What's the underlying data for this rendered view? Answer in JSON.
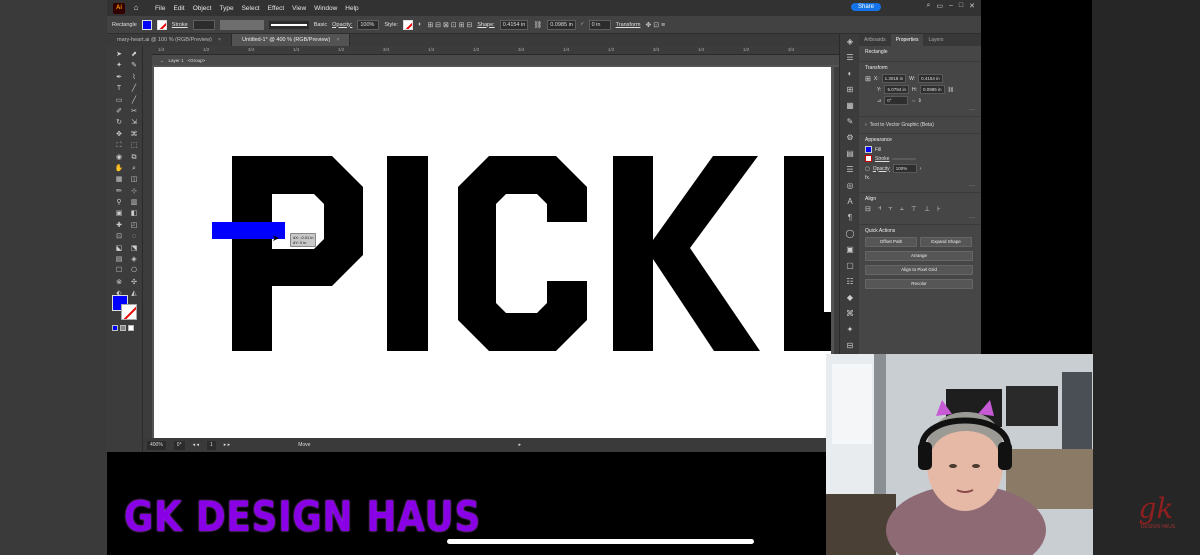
{
  "app": {
    "logo_text": "Ai",
    "menu": [
      "File",
      "Edit",
      "Object",
      "Type",
      "Select",
      "Effect",
      "View",
      "Window",
      "Help"
    ],
    "share_label": "Share"
  },
  "control_bar": {
    "object_type": "Rectangle",
    "stroke_label": "Stroke",
    "brush_label": "Basic",
    "opacity_label": "Opacity:",
    "opacity_value": "100%",
    "style_label": "Style:",
    "shape_label": "Shape:",
    "width_value": "0.4154 in",
    "height_value": "0.0985 in",
    "angle_value": "0 in",
    "transform_label": "Transform"
  },
  "tabs": [
    {
      "label": "mary-heart.ai @ 100 % (RGB/Preview)"
    },
    {
      "label": "Untitled-1* @ 400 % (RGB/Preview)"
    }
  ],
  "ruler_ticks": [
    "1/4",
    "1/2",
    "3/4",
    "1/4",
    "1/2",
    "3/4",
    "1/4",
    "1/2",
    "3/4",
    "1/4",
    "1/2",
    "3/4",
    "1/4",
    "1/2",
    "3/4"
  ],
  "breadcrumb": {
    "layer": "Layer 1",
    "group": "<Group>"
  },
  "artwork": {
    "text": "PICKL",
    "fill_color": "#000000",
    "rect_color": "#0000ff"
  },
  "tooltip": {
    "dx": "dX: -0.01 in",
    "dy": "dY: 0 in"
  },
  "status_bar": {
    "zoom": "400%",
    "angle": "0°",
    "artboard": "1",
    "tool": "Move"
  },
  "panel": {
    "tabs": [
      "Artboards",
      "Properties",
      "Layers"
    ],
    "selection": "Rectangle",
    "transform_title": "Transform",
    "x_label": "X:",
    "x_value": "1.3018 in",
    "y_label": "Y:",
    "y_value": "5.0794 in",
    "w_label": "W:",
    "w_value": "0.4154 in",
    "h_label": "H:",
    "h_value": "0.0985 in",
    "rotate_value": "0°",
    "text_to_vector": "Text to Vector Graphic (Beta)",
    "appearance_title": "Appearance",
    "fill_label": "Fill",
    "stroke_label": "Stroke",
    "opacity_label": "Opacity",
    "opacity_value": "100%",
    "fx_label": "fx.",
    "align_title": "Align",
    "quick_actions_title": "Quick Actions",
    "offset_path": "Offset Path",
    "expand_shape": "Expand Shape",
    "arrange": "Arrange",
    "align_pixel": "Align to Pixel Grid",
    "recolor": "Recolor"
  },
  "branding": {
    "title": "GK DESIGN HAUS",
    "logo_letters": "gk",
    "logo_caption": "DESIGN HAUS"
  },
  "colors": {
    "fill": "#0000ff",
    "brand_purple": "#8a00e6",
    "share_blue": "#1473e6"
  }
}
